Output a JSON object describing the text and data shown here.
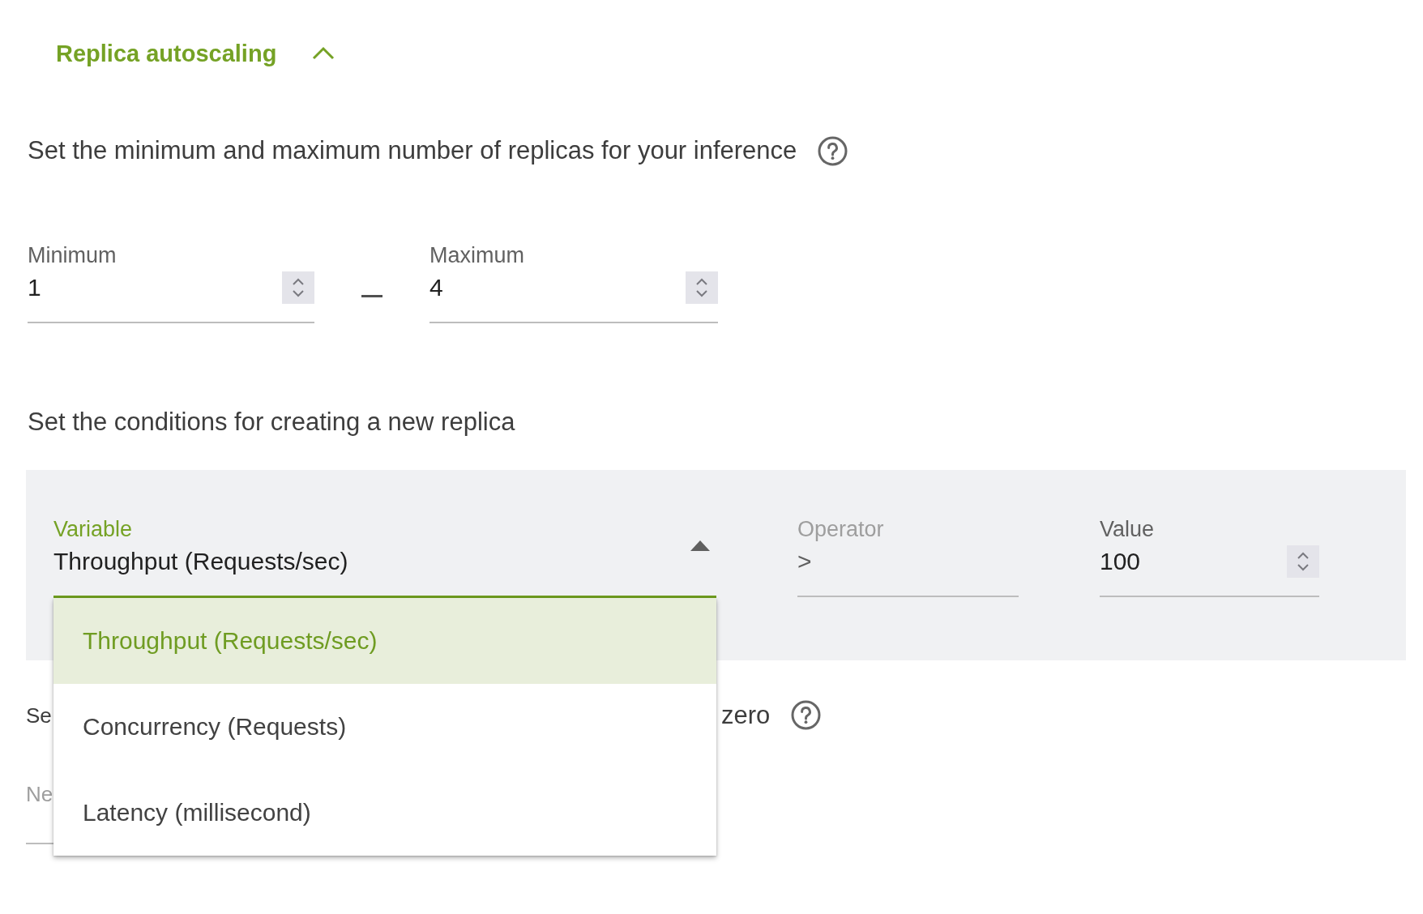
{
  "section": {
    "title": "Replica autoscaling",
    "expanded": true
  },
  "replica_limits": {
    "description": "Set the minimum and maximum number of replicas for your inference",
    "minimum": {
      "label": "Minimum",
      "value": "1"
    },
    "maximum": {
      "label": "Maximum",
      "value": "4"
    }
  },
  "conditions": {
    "description": "Set the conditions for creating a new replica",
    "variable": {
      "label": "Variable",
      "value": "Throughput (Requests/sec)",
      "expanded": true,
      "options": [
        {
          "label": "Throughput (Requests/sec)",
          "selected": true
        },
        {
          "label": "Concurrency (Requests)",
          "selected": false
        },
        {
          "label": "Latency (millisecond)",
          "selected": false
        }
      ]
    },
    "operator": {
      "label": "Operator",
      "value": ">",
      "disabled": true
    },
    "value": {
      "label": "Value",
      "value": "100"
    }
  },
  "covered_setting": {
    "description_start": "Se",
    "description_end": "zero",
    "input": {
      "placeholder": "Ne"
    }
  }
}
